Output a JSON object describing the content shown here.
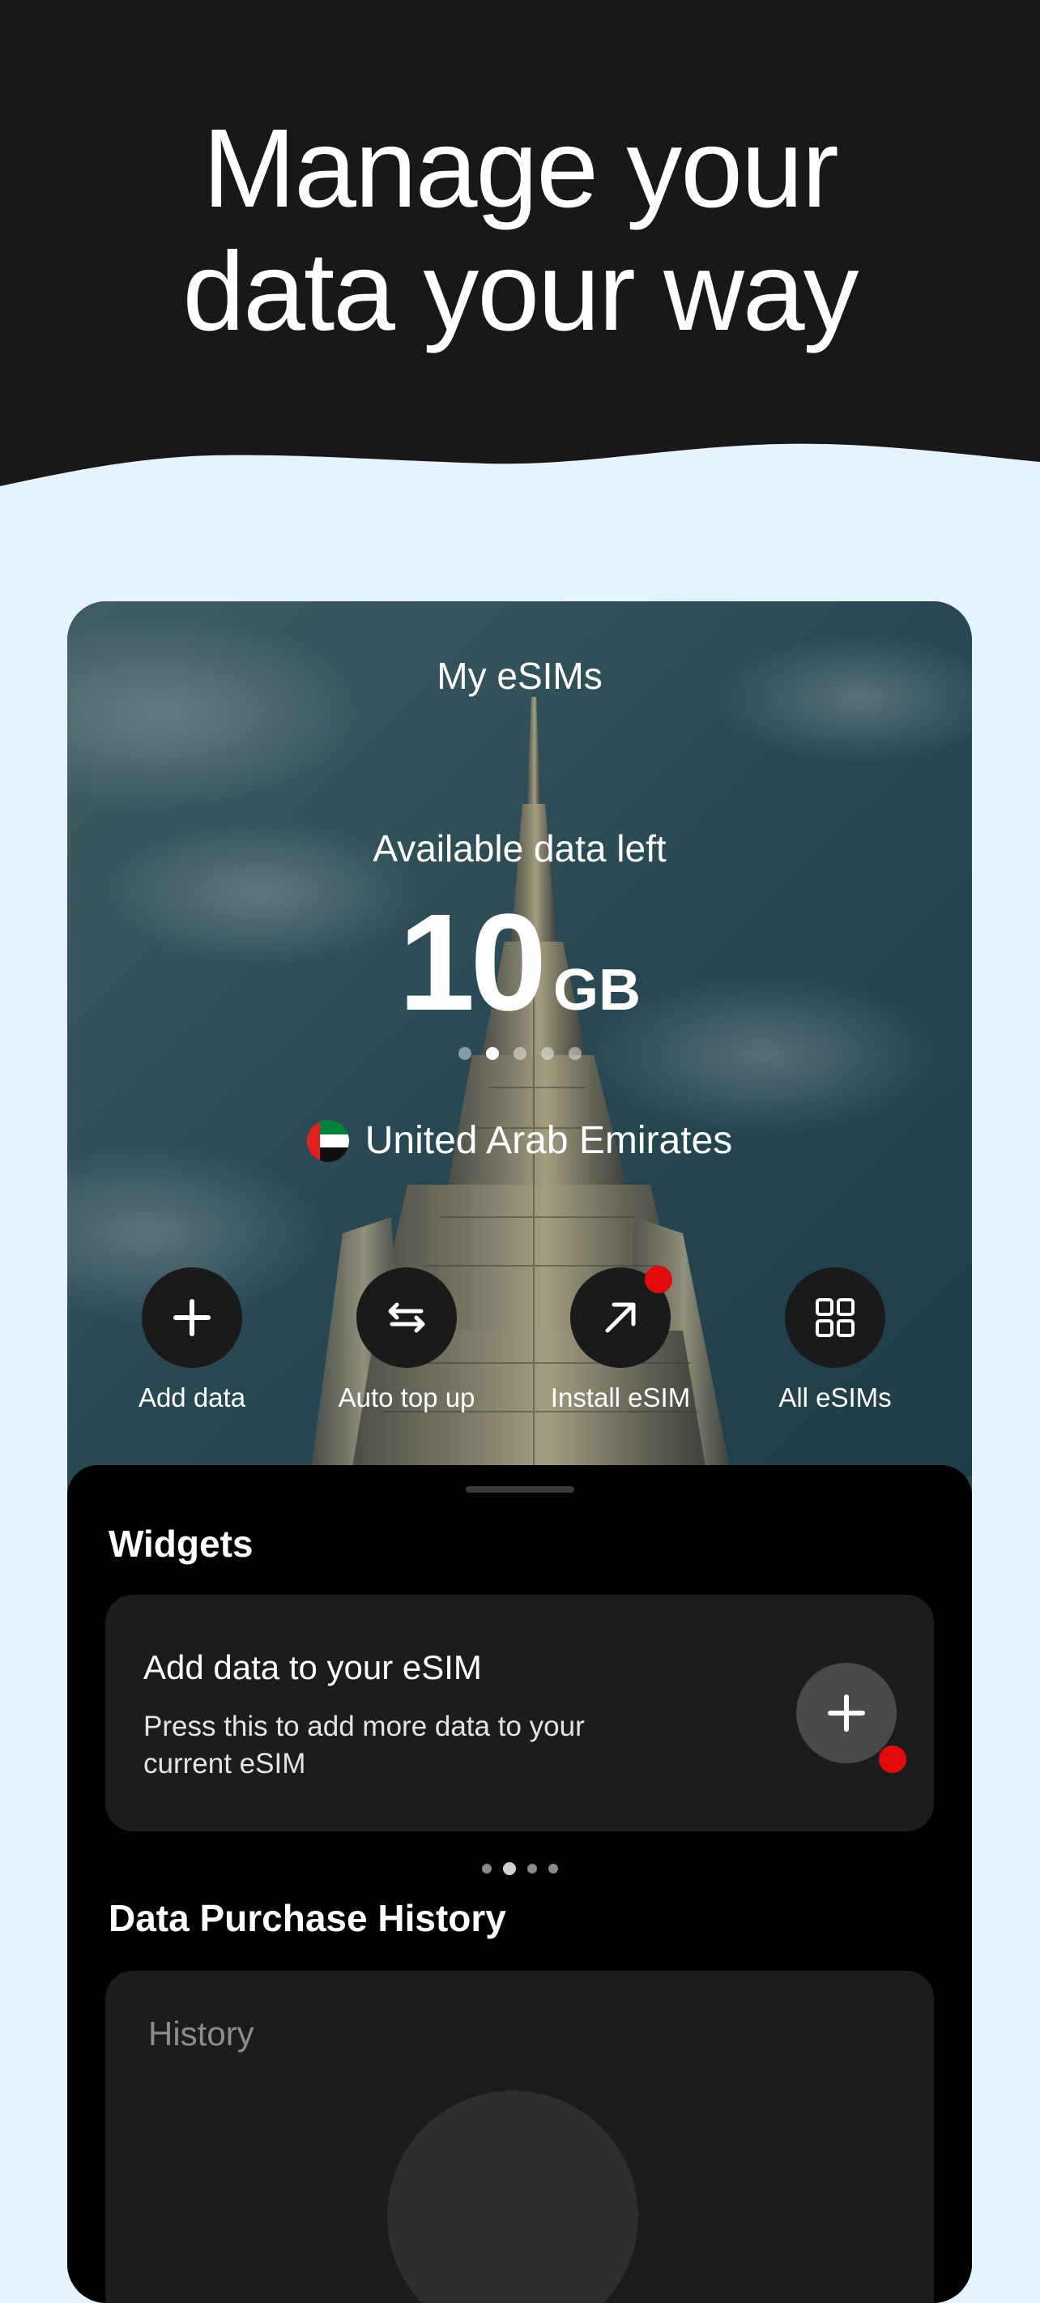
{
  "hero": {
    "title_line1": "Manage your",
    "title_line2": "data your way"
  },
  "esims": {
    "screen_title": "My eSIMs",
    "available_label": "Available data left",
    "amount": "10",
    "unit": "GB",
    "page_dots": 5,
    "active_dot": 1,
    "country": "United Arab Emirates",
    "actions": [
      {
        "label": "Add data",
        "icon": "plus-icon"
      },
      {
        "label": "Auto top up",
        "icon": "swap-arrows-icon"
      },
      {
        "label": "Install eSIM",
        "icon": "arrow-up-right-icon",
        "badge": true
      },
      {
        "label": "All eSIMs",
        "icon": "grid-icon"
      }
    ]
  },
  "widgets": {
    "section_title": "Widgets",
    "card_title": "Add data to your eSIM",
    "card_description": "Press this to add more data to your current eSIM",
    "button_icon": "plus-icon",
    "page_dots": 4,
    "active_dot": 1
  },
  "history": {
    "section_title": "Data Purchase History",
    "card_label": "History"
  },
  "colors": {
    "hero_background": "#181818",
    "page_background": "#e6f2fe",
    "sheet_background": "#000000",
    "card_background": "#1c1c1c",
    "badge_red": "#e10b0b"
  }
}
